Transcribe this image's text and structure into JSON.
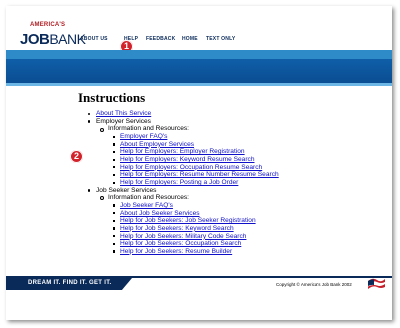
{
  "header": {
    "logo": {
      "top_text": "AMERICA'S",
      "word1": "JOB",
      "word2": "BANK"
    },
    "nav": [
      {
        "label": "ABOUT US"
      },
      {
        "label": "HELP"
      },
      {
        "label": "FEEDBACK"
      },
      {
        "label": "HOME"
      },
      {
        "label": "TEXT ONLY"
      }
    ],
    "annotation_1": "1"
  },
  "page": {
    "title": "Instructions",
    "annotation_2": "2",
    "about": "About This Service",
    "employer": {
      "label": "Employer Services",
      "sub": "Information and Resources:",
      "links": [
        "Employer FAQ's",
        "About Employer Services",
        "Help for Employers: Employer Registration",
        "Help for Employers: Keyword Resume Search",
        "Help for Employers: Occupation Resume Search",
        "Help for Employers: Resume Number Resume Search",
        "Help for Employers: Posting a Job Order"
      ]
    },
    "jobseeker": {
      "label": "Job Seeker Services",
      "sub": "Information and Resources:",
      "links": [
        "Job Seeker FAQ's",
        "About Job Seeker Services",
        "Help for Job Seekers: Job Seeker Registration",
        "Help for Job Seekers: Keyword Search",
        "Help for Job Seekers: Military Code Search",
        "Help for Job Seekers: Occupation Search",
        "Help for Job Seekers: Resume Builder"
      ]
    }
  },
  "footer": {
    "slogan": "DREAM IT. FIND IT. GET IT.",
    "copyright": "Copyright © America's Job Bank 2002"
  },
  "colors": {
    "navy": "#0a2a5a",
    "banner_blue": "#0f5fa8",
    "banner_light": "#2f8ac8",
    "link_blue": "#1010c8",
    "marker_red": "#d4222b"
  }
}
